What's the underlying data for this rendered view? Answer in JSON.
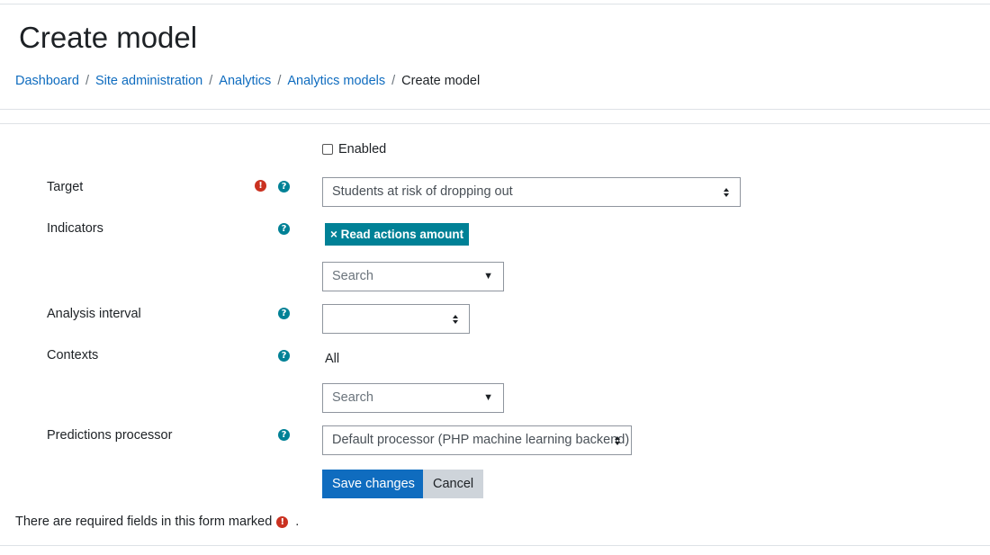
{
  "page": {
    "title": "Create model"
  },
  "breadcrumb": {
    "items": [
      "Dashboard",
      "Site administration",
      "Analytics",
      "Analytics models"
    ],
    "separator": "/",
    "current": "Create model"
  },
  "form": {
    "enabled": {
      "label": "Enabled",
      "checked": false
    },
    "target": {
      "label": "Target",
      "value": "Students at risk of dropping out",
      "required": true
    },
    "indicators": {
      "label": "Indicators",
      "selected_tags": [
        "× Read actions amount"
      ],
      "search_placeholder": "Search"
    },
    "analysis_interval": {
      "label": "Analysis interval",
      "value": ""
    },
    "contexts": {
      "label": "Contexts",
      "value": "All",
      "search_placeholder": "Search"
    },
    "predictions_processor": {
      "label": "Predictions processor",
      "value": "Default processor (PHP machine learning backend)"
    },
    "buttons": {
      "save": "Save changes",
      "cancel": "Cancel"
    },
    "required_note": {
      "text": "There are required fields in this form marked",
      "suffix": "."
    }
  },
  "icons": {
    "help": "question-circle-icon",
    "required": "exclamation-circle-icon",
    "dropdown": "caret-down-icon",
    "select_arrows": "sort-arrows-icon"
  },
  "colors": {
    "link": "#0f6cbf",
    "primary_button": "#0f6cbf",
    "help_icon": "#008196",
    "tag": "#008196",
    "required_icon": "#ca3120"
  }
}
